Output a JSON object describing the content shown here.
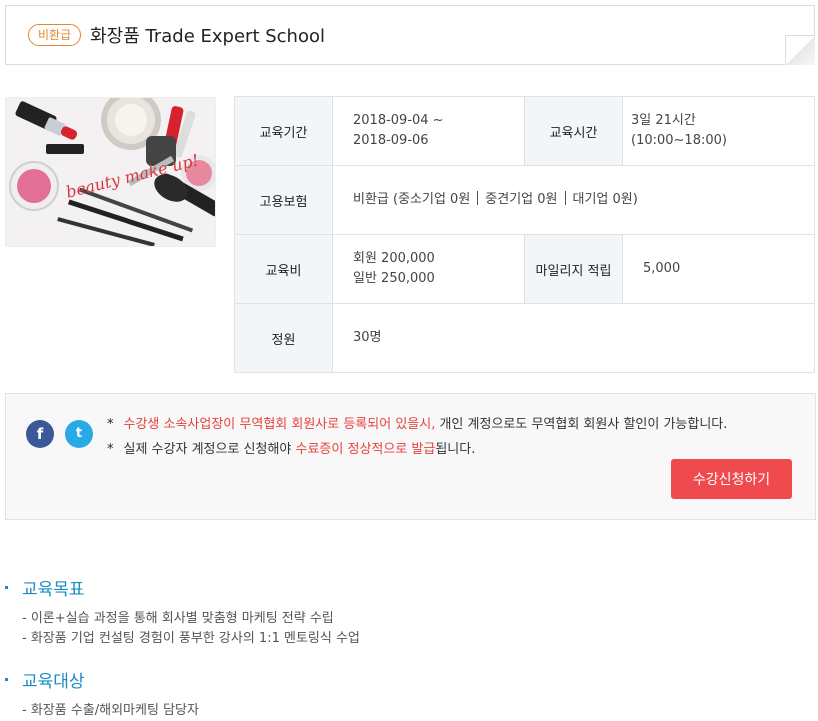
{
  "header": {
    "badge": "비환급",
    "title": "화장품 Trade Expert School"
  },
  "image": {
    "alt": "beauty make up cosmetics",
    "script_text": "beauty make up!"
  },
  "info": {
    "period_label": "교육기간",
    "period_line1": "2018-09-04 ~",
    "period_line2": "2018-09-06",
    "time_label": "교육시간",
    "time_line1": "3일 21시간",
    "time_line2": "(10:00~18:00)",
    "insurance_label": "고용보험",
    "insurance_a": "비환급 (중소기업 0원",
    "insurance_b": "중견기업 0원",
    "insurance_c": "대기업 0원)",
    "fee_label": "교육비",
    "fee_member": "회원 200,000",
    "fee_general": "일반 250,000",
    "mileage_label": "마일리지 적립",
    "mileage_value": "5,000",
    "capacity_label": "정원",
    "capacity_value": "30명"
  },
  "notice": {
    "star": "*",
    "line1_red": "수강생 소속사업장이 무역협회 회원사로 등록되어 있을시,",
    "line1_rest": " 개인 계정으로도 무역협회 회원사 할인이 가능합니다.",
    "line2_a": "실제 수강자 계정으로 신청해야 ",
    "line2_red": "수료증이 정상적으로 발급",
    "line2_b": "됩니다.",
    "facebook_glyph": "f",
    "twitter_glyph": "t",
    "apply_label": "수강신청하기"
  },
  "sections": {
    "goal_title": "교육목표",
    "goal_items": [
      "- 이론+실습 과정을 통해 회사별 맞춤형 마케팅 전략 수립",
      "- 화장품 기업 컨설팅 경험이 풍부한 강사의 1:1 멘토링식 수업"
    ],
    "target_title": "교육대상",
    "target_items": [
      "- 화장품 수출/해외마케팅 담당자"
    ]
  },
  "colors": {
    "badge": "#e3872f",
    "accent_red": "#e8413e",
    "button": "#ef4b4f",
    "section_blue": "#1b8cc3",
    "facebook": "#3b5998",
    "twitter": "#29a9e6"
  }
}
